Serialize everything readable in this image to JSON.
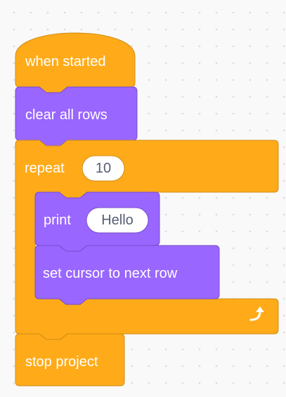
{
  "script": {
    "hat_label": "when started",
    "clear_label": "clear all rows",
    "repeat_label": "repeat",
    "repeat_count": "10",
    "print_label": "print",
    "print_text": "Hello",
    "cursor_label": "set cursor to next row",
    "stop_label": "stop project",
    "loop_icon": "loop-arrow-icon"
  },
  "colors": {
    "control": "#FFAB19",
    "control_stroke": "#CF8B17",
    "looks": "#9966FF",
    "looks_stroke": "#774DCB",
    "canvas_bg": "#F9F9F9",
    "grid_dot": "#DCDCDC",
    "input_text": "#575E75"
  }
}
